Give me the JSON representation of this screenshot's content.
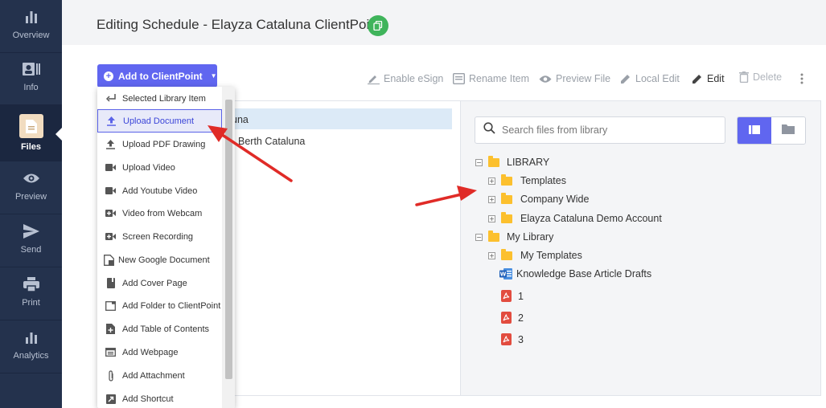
{
  "sidebar": {
    "items": [
      {
        "label": "Overview",
        "icon": "bar-chart-icon"
      },
      {
        "label": "Info",
        "icon": "contact-card-icon"
      },
      {
        "label": "Files",
        "icon": "file-icon"
      },
      {
        "label": "Preview",
        "icon": "eye-icon"
      },
      {
        "label": "Send",
        "icon": "send-icon"
      },
      {
        "label": "Print",
        "icon": "printer-icon"
      },
      {
        "label": "Analytics",
        "icon": "analytics-icon"
      }
    ],
    "active": "Files"
  },
  "header": {
    "title": "Editing Schedule - Elayza Cataluna ClientPoint",
    "copy_icon": "copy-icon"
  },
  "add_button": {
    "label": "Add to ClientPoint"
  },
  "toolbar": {
    "enable_esign": "Enable eSign",
    "rename_item": "Rename Item",
    "preview_file": "Preview File",
    "local_edit": "Local Edit",
    "edit": "Edit",
    "delete": "Delete"
  },
  "dropdown": {
    "items": [
      {
        "label": "Selected Library Item",
        "icon": "return-arrow-icon"
      },
      {
        "label": "Upload Document",
        "icon": "upload-icon",
        "highlighted": true
      },
      {
        "label": "Upload PDF Drawing",
        "icon": "upload-icon"
      },
      {
        "label": "Upload Video",
        "icon": "video-camera-icon"
      },
      {
        "label": "Add Youtube Video",
        "icon": "video-camera-icon"
      },
      {
        "label": "Video from Webcam",
        "icon": "video-plus-icon"
      },
      {
        "label": "Screen Recording",
        "icon": "video-plus-icon"
      },
      {
        "label": "New Google Document",
        "icon": "document-icon"
      },
      {
        "label": "Add Cover Page",
        "icon": "book-icon"
      },
      {
        "label": "Add Folder to ClientPoint",
        "icon": "folder-outline-icon"
      },
      {
        "label": "Add Table of Contents",
        "icon": "toc-icon"
      },
      {
        "label": "Add Webpage",
        "icon": "webpage-icon"
      },
      {
        "label": "Add Attachment",
        "icon": "paperclip-icon"
      },
      {
        "label": "Add Shortcut",
        "icon": "shortcut-icon"
      }
    ]
  },
  "middle": {
    "rows": [
      "una",
      "Berth Cataluna"
    ]
  },
  "library": {
    "search_placeholder": "Search files from library",
    "tree": [
      {
        "label": "LIBRARY",
        "expander": "−",
        "type": "folder"
      },
      {
        "label": "Templates",
        "expander": "+",
        "type": "folder"
      },
      {
        "label": "Company Wide",
        "expander": "+",
        "type": "folder"
      },
      {
        "label": "Elayza Cataluna Demo Account",
        "expander": "+",
        "type": "folder"
      },
      {
        "label": "My Library",
        "expander": "−",
        "type": "folder"
      },
      {
        "label": "My Templates",
        "expander": "+",
        "type": "folder"
      },
      {
        "label": "Knowledge Base Article Drafts",
        "type": "word"
      },
      {
        "label": "1",
        "type": "pdf"
      },
      {
        "label": "2",
        "type": "pdf"
      },
      {
        "label": "3",
        "type": "pdf"
      }
    ]
  },
  "colors": {
    "sidebar_bg": "#24324d",
    "accent": "#6066f0",
    "copy_badge": "#3fb45b",
    "folder": "#fcc02e",
    "pdf": "#e24c3f",
    "annotation_arrow": "#e02b27"
  }
}
